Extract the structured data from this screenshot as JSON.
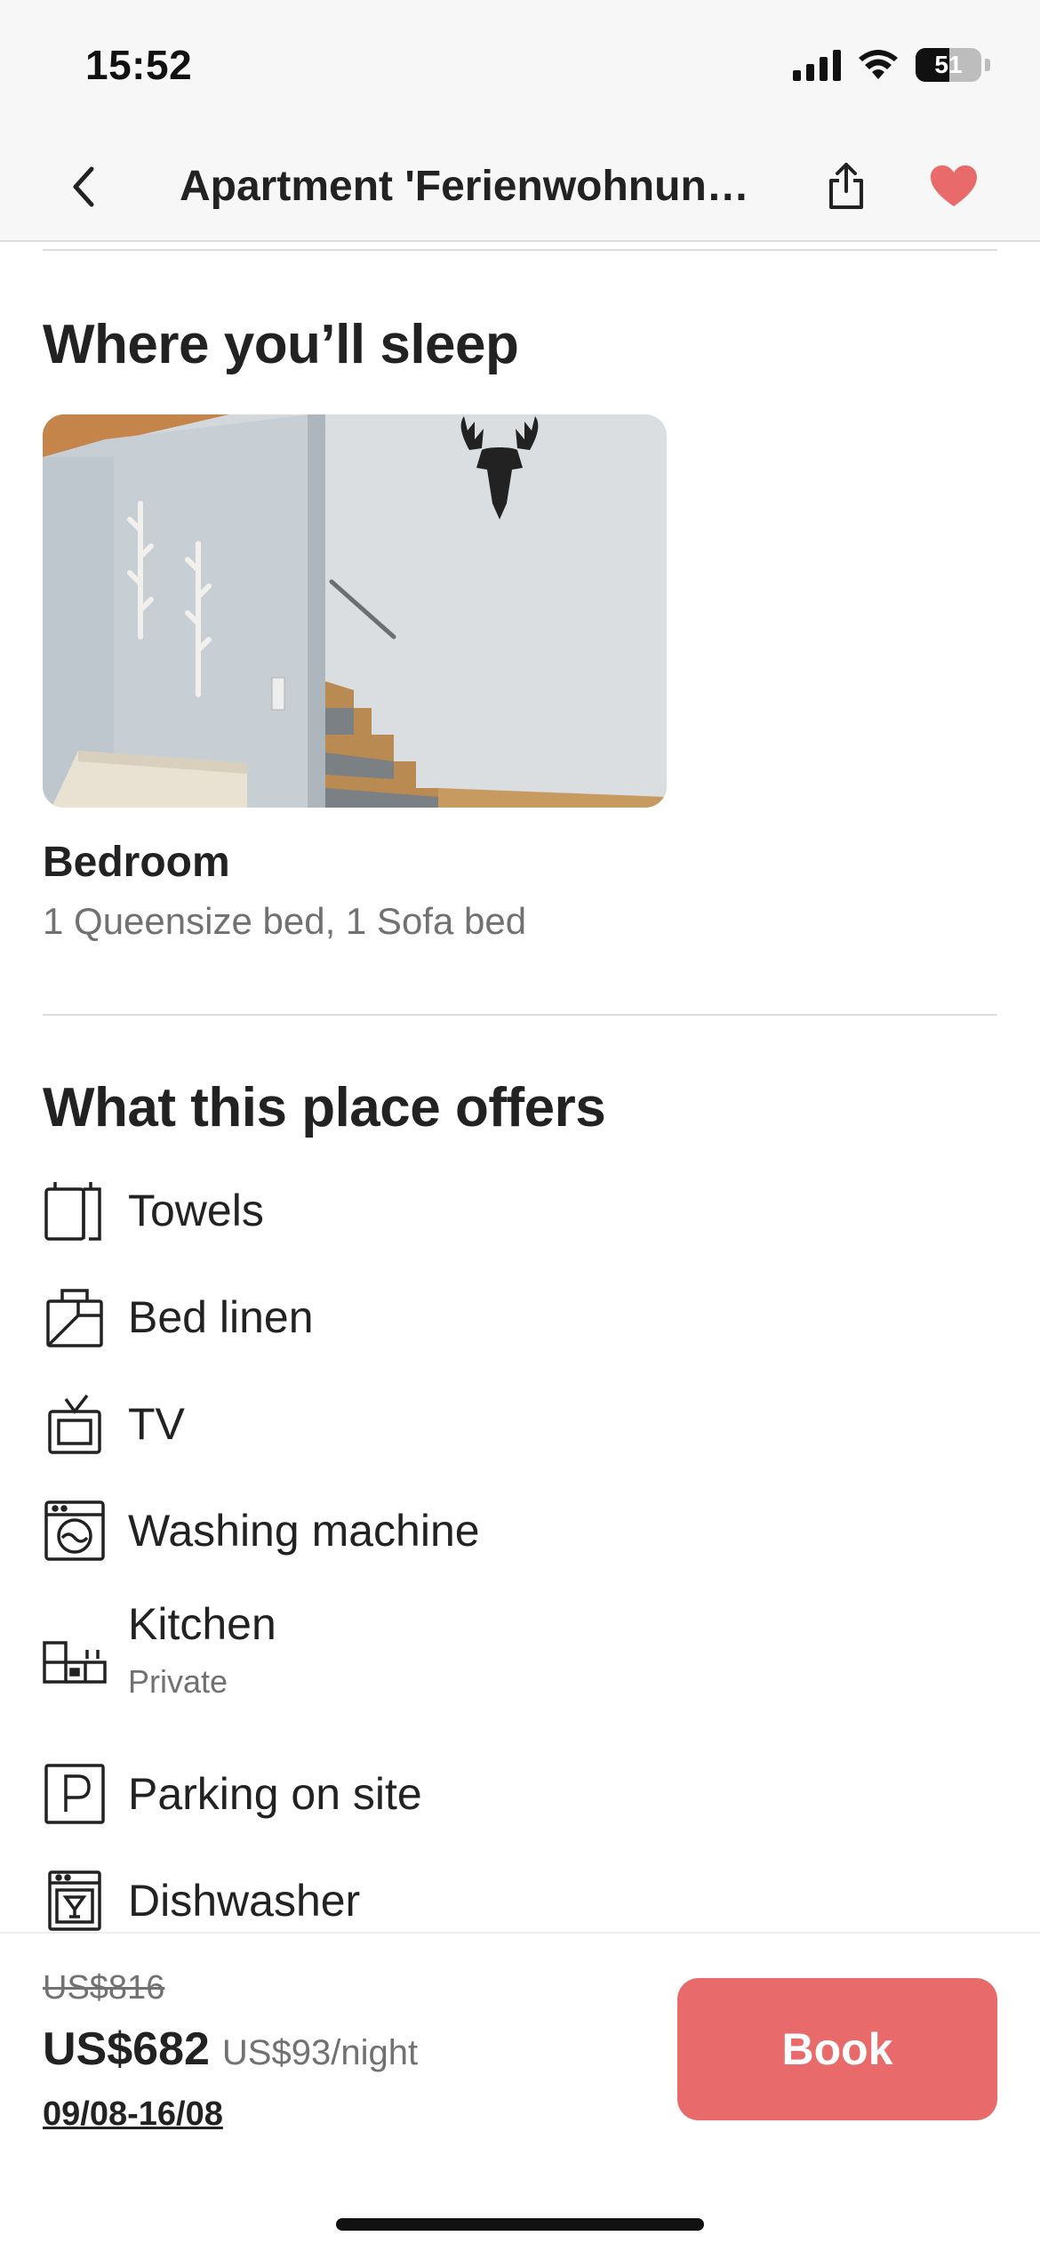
{
  "status_bar": {
    "time": "15:52",
    "battery": "51"
  },
  "header": {
    "title": "Apartment 'Ferienwohnun…"
  },
  "sleep": {
    "title": "Where you’ll sleep",
    "room_name": "Bedroom",
    "room_beds": "1 Queensize bed, 1 Sofa bed"
  },
  "offers": {
    "title": "What this place offers",
    "items": [
      {
        "label": "Towels",
        "icon": "towels-icon"
      },
      {
        "label": "Bed linen",
        "icon": "bed-linen-icon"
      },
      {
        "label": "TV",
        "icon": "tv-icon"
      },
      {
        "label": "Washing machine",
        "icon": "washing-machine-icon"
      },
      {
        "label": "Kitchen",
        "sub": "Private",
        "icon": "kitchen-icon"
      },
      {
        "label": "Parking on site",
        "icon": "parking-icon"
      },
      {
        "label": "Dishwasher",
        "icon": "dishwasher-icon"
      }
    ]
  },
  "booking": {
    "old_price": "US$816",
    "price": "US$682",
    "per_night": "US$93/night",
    "dates": "09/08-16/08",
    "book_label": "Book"
  },
  "colors": {
    "accent": "#e96a6a",
    "text": "#222222",
    "muted": "#717171"
  }
}
